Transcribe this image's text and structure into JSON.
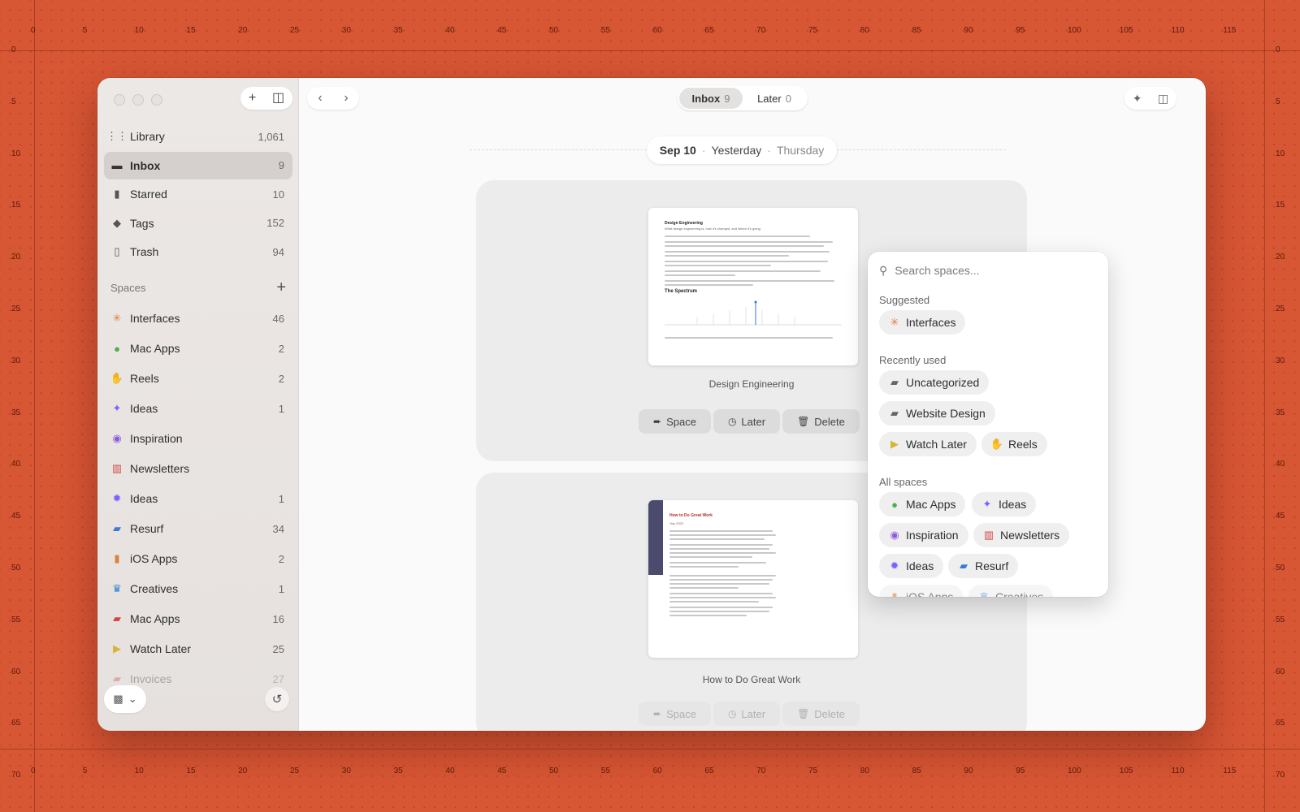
{
  "colors": {
    "background": "#D75634",
    "interfaces": "#E07B39",
    "macapps": "#4CAF50",
    "reels": "#E08A3C",
    "ideas_purple": "#7B61FF",
    "inspiration": "#8E5BD9",
    "newsletters": "#D64545",
    "resurf": "#3A7BD5",
    "ios": "#D9823A",
    "creatives": "#2F80D6",
    "watchlater": "#D8B43A"
  },
  "ruler": {
    "h_labels": [
      "0",
      "5",
      "10",
      "15",
      "20",
      "25",
      "30",
      "35",
      "40",
      "45",
      "50",
      "55",
      "60",
      "65",
      "70",
      "75",
      "80",
      "85",
      "90",
      "95",
      "100",
      "105",
      "110",
      "115"
    ],
    "v_labels": [
      "0",
      "5",
      "10",
      "15",
      "20",
      "25",
      "30",
      "35",
      "40",
      "45",
      "50",
      "55",
      "60",
      "65",
      "70"
    ]
  },
  "sidebar": {
    "top_items": [
      {
        "label": "Library",
        "count": "1,061",
        "icon": "grid-icon"
      },
      {
        "label": "Inbox",
        "count": "9",
        "icon": "inbox-icon"
      },
      {
        "label": "Starred",
        "count": "10",
        "icon": "bookmark-icon"
      },
      {
        "label": "Tags",
        "count": "152",
        "icon": "tag-icon"
      },
      {
        "label": "Trash",
        "count": "94",
        "icon": "trash-icon"
      }
    ],
    "spaces_label": "Spaces",
    "spaces": [
      {
        "label": "Interfaces",
        "count": "46",
        "icon": "asterisk-icon"
      },
      {
        "label": "Mac Apps",
        "count": "2",
        "icon": "apple-icon"
      },
      {
        "label": "Reels",
        "count": "2",
        "icon": "hand-icon"
      },
      {
        "label": "Ideas",
        "count": "1",
        "icon": "sparkle-icon"
      },
      {
        "label": "Inspiration",
        "count": "",
        "icon": "compass-icon"
      },
      {
        "label": "Newsletters",
        "count": "",
        "icon": "book-icon"
      },
      {
        "label": "Ideas",
        "count": "1",
        "icon": "lightbulb-icon"
      },
      {
        "label": "Resurf",
        "count": "34",
        "icon": "folder-icon"
      },
      {
        "label": "iOS Apps",
        "count": "2",
        "icon": "phone-icon"
      },
      {
        "label": "Creatives",
        "count": "1",
        "icon": "crown-icon"
      },
      {
        "label": "Mac Apps",
        "count": "16",
        "icon": "folder-icon"
      },
      {
        "label": "Watch Later",
        "count": "25",
        "icon": "play-icon"
      },
      {
        "label": "Invoices",
        "count": "27",
        "icon": "folder-icon"
      }
    ]
  },
  "toolbar": {
    "segments": [
      {
        "label": "Inbox",
        "count": "9"
      },
      {
        "label": "Later",
        "count": "0"
      }
    ]
  },
  "date_header": {
    "date": "Sep 10",
    "relative": "Yesterday",
    "weekday": "Thursday"
  },
  "cards": [
    {
      "title": "Design Engineering",
      "doc_heading": "Design Engineering",
      "doc_sub": "What design engineering is, how it's changed, and where it's going",
      "doc_section": "The Spectrum"
    },
    {
      "title": "How to Do Great Work",
      "doc_heading": "How to Do Great Work",
      "doc_sub": "July 2023"
    }
  ],
  "actions": {
    "space": "Space",
    "later": "Later",
    "delete": "Delete"
  },
  "popover": {
    "search_placeholder": "Search spaces...",
    "suggested_label": "Suggested",
    "suggested": [
      {
        "label": "Interfaces",
        "icon": "asterisk-icon"
      }
    ],
    "recent_label": "Recently used",
    "recent": [
      {
        "label": "Uncategorized",
        "icon": "folder-icon"
      },
      {
        "label": "Website Design",
        "icon": "folder-icon"
      },
      {
        "label": "Watch Later",
        "icon": "play-icon"
      },
      {
        "label": "Reels",
        "icon": "hand-icon"
      }
    ],
    "all_label": "All spaces",
    "all": [
      {
        "label": "Mac Apps",
        "icon": "apple-icon"
      },
      {
        "label": "Ideas",
        "icon": "sparkle-icon"
      },
      {
        "label": "Inspiration",
        "icon": "compass-icon"
      },
      {
        "label": "Newsletters",
        "icon": "book-icon"
      },
      {
        "label": "Ideas",
        "icon": "lightbulb-icon"
      },
      {
        "label": "Resurf",
        "icon": "folder-icon"
      },
      {
        "label": "iOS Apps",
        "icon": "phone-icon"
      },
      {
        "label": "Creatives",
        "icon": "crown-icon"
      }
    ]
  }
}
